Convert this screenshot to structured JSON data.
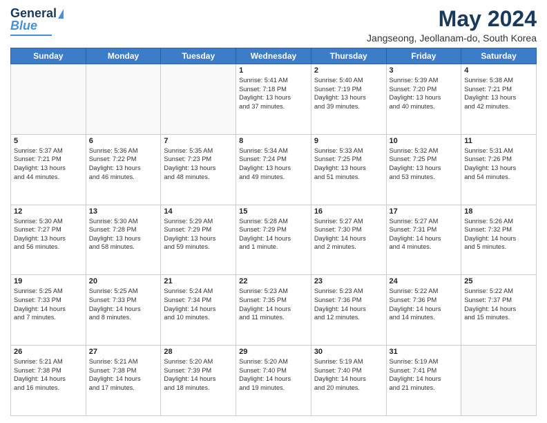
{
  "logo": {
    "line1": "General",
    "line2": "Blue"
  },
  "title": "May 2024",
  "location": "Jangseong, Jeollanam-do, South Korea",
  "days_of_week": [
    "Sunday",
    "Monday",
    "Tuesday",
    "Wednesday",
    "Thursday",
    "Friday",
    "Saturday"
  ],
  "weeks": [
    [
      {
        "day": "",
        "text": ""
      },
      {
        "day": "",
        "text": ""
      },
      {
        "day": "",
        "text": ""
      },
      {
        "day": "1",
        "text": "Sunrise: 5:41 AM\nSunset: 7:18 PM\nDaylight: 13 hours\nand 37 minutes."
      },
      {
        "day": "2",
        "text": "Sunrise: 5:40 AM\nSunset: 7:19 PM\nDaylight: 13 hours\nand 39 minutes."
      },
      {
        "day": "3",
        "text": "Sunrise: 5:39 AM\nSunset: 7:20 PM\nDaylight: 13 hours\nand 40 minutes."
      },
      {
        "day": "4",
        "text": "Sunrise: 5:38 AM\nSunset: 7:21 PM\nDaylight: 13 hours\nand 42 minutes."
      }
    ],
    [
      {
        "day": "5",
        "text": "Sunrise: 5:37 AM\nSunset: 7:21 PM\nDaylight: 13 hours\nand 44 minutes."
      },
      {
        "day": "6",
        "text": "Sunrise: 5:36 AM\nSunset: 7:22 PM\nDaylight: 13 hours\nand 46 minutes."
      },
      {
        "day": "7",
        "text": "Sunrise: 5:35 AM\nSunset: 7:23 PM\nDaylight: 13 hours\nand 48 minutes."
      },
      {
        "day": "8",
        "text": "Sunrise: 5:34 AM\nSunset: 7:24 PM\nDaylight: 13 hours\nand 49 minutes."
      },
      {
        "day": "9",
        "text": "Sunrise: 5:33 AM\nSunset: 7:25 PM\nDaylight: 13 hours\nand 51 minutes."
      },
      {
        "day": "10",
        "text": "Sunrise: 5:32 AM\nSunset: 7:25 PM\nDaylight: 13 hours\nand 53 minutes."
      },
      {
        "day": "11",
        "text": "Sunrise: 5:31 AM\nSunset: 7:26 PM\nDaylight: 13 hours\nand 54 minutes."
      }
    ],
    [
      {
        "day": "12",
        "text": "Sunrise: 5:30 AM\nSunset: 7:27 PM\nDaylight: 13 hours\nand 56 minutes."
      },
      {
        "day": "13",
        "text": "Sunrise: 5:30 AM\nSunset: 7:28 PM\nDaylight: 13 hours\nand 58 minutes."
      },
      {
        "day": "14",
        "text": "Sunrise: 5:29 AM\nSunset: 7:29 PM\nDaylight: 13 hours\nand 59 minutes."
      },
      {
        "day": "15",
        "text": "Sunrise: 5:28 AM\nSunset: 7:29 PM\nDaylight: 14 hours\nand 1 minute."
      },
      {
        "day": "16",
        "text": "Sunrise: 5:27 AM\nSunset: 7:30 PM\nDaylight: 14 hours\nand 2 minutes."
      },
      {
        "day": "17",
        "text": "Sunrise: 5:27 AM\nSunset: 7:31 PM\nDaylight: 14 hours\nand 4 minutes."
      },
      {
        "day": "18",
        "text": "Sunrise: 5:26 AM\nSunset: 7:32 PM\nDaylight: 14 hours\nand 5 minutes."
      }
    ],
    [
      {
        "day": "19",
        "text": "Sunrise: 5:25 AM\nSunset: 7:33 PM\nDaylight: 14 hours\nand 7 minutes."
      },
      {
        "day": "20",
        "text": "Sunrise: 5:25 AM\nSunset: 7:33 PM\nDaylight: 14 hours\nand 8 minutes."
      },
      {
        "day": "21",
        "text": "Sunrise: 5:24 AM\nSunset: 7:34 PM\nDaylight: 14 hours\nand 10 minutes."
      },
      {
        "day": "22",
        "text": "Sunrise: 5:23 AM\nSunset: 7:35 PM\nDaylight: 14 hours\nand 11 minutes."
      },
      {
        "day": "23",
        "text": "Sunrise: 5:23 AM\nSunset: 7:36 PM\nDaylight: 14 hours\nand 12 minutes."
      },
      {
        "day": "24",
        "text": "Sunrise: 5:22 AM\nSunset: 7:36 PM\nDaylight: 14 hours\nand 14 minutes."
      },
      {
        "day": "25",
        "text": "Sunrise: 5:22 AM\nSunset: 7:37 PM\nDaylight: 14 hours\nand 15 minutes."
      }
    ],
    [
      {
        "day": "26",
        "text": "Sunrise: 5:21 AM\nSunset: 7:38 PM\nDaylight: 14 hours\nand 16 minutes."
      },
      {
        "day": "27",
        "text": "Sunrise: 5:21 AM\nSunset: 7:38 PM\nDaylight: 14 hours\nand 17 minutes."
      },
      {
        "day": "28",
        "text": "Sunrise: 5:20 AM\nSunset: 7:39 PM\nDaylight: 14 hours\nand 18 minutes."
      },
      {
        "day": "29",
        "text": "Sunrise: 5:20 AM\nSunset: 7:40 PM\nDaylight: 14 hours\nand 19 minutes."
      },
      {
        "day": "30",
        "text": "Sunrise: 5:19 AM\nSunset: 7:40 PM\nDaylight: 14 hours\nand 20 minutes."
      },
      {
        "day": "31",
        "text": "Sunrise: 5:19 AM\nSunset: 7:41 PM\nDaylight: 14 hours\nand 21 minutes."
      },
      {
        "day": "",
        "text": ""
      }
    ]
  ]
}
